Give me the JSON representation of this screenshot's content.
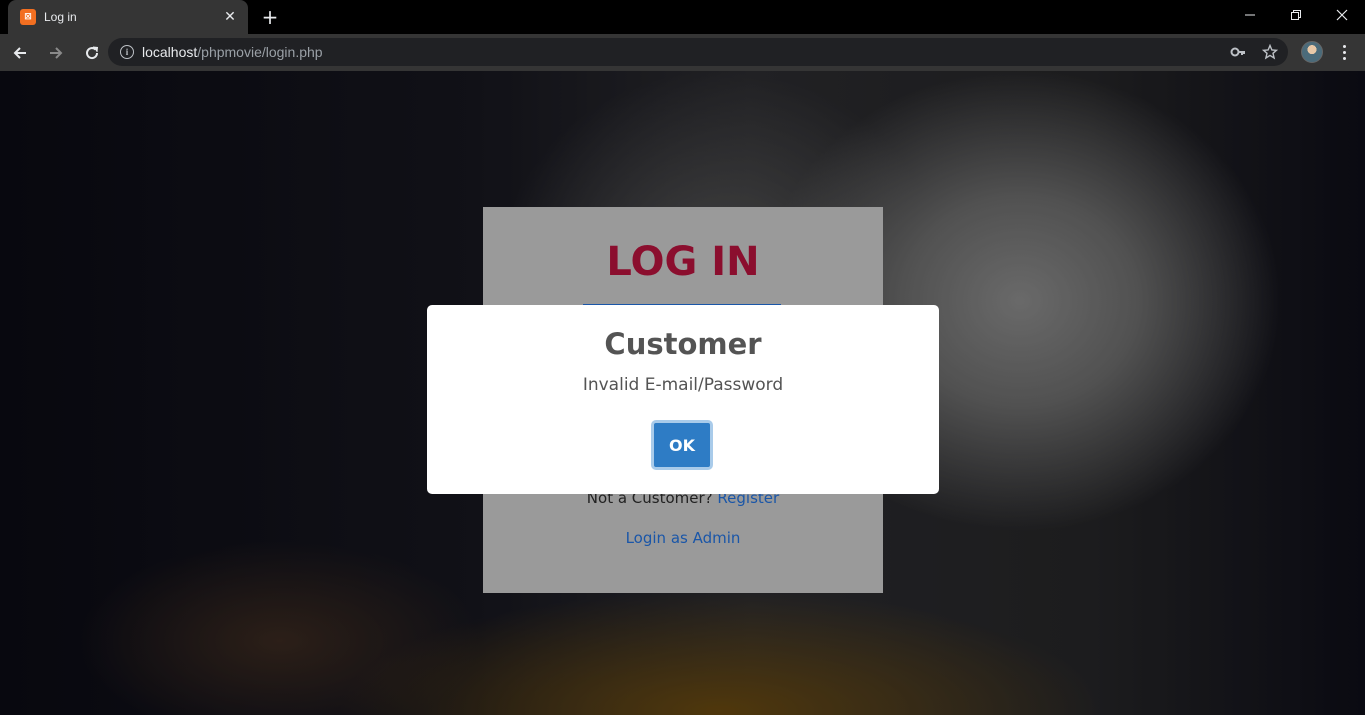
{
  "browser": {
    "tab_title": "Log in",
    "tab_favicon": "xampp-icon",
    "new_tab_label": "+",
    "url_host": "localhost",
    "url_path": "/phpmovie/login.php"
  },
  "login_card": {
    "title": "LOG IN",
    "not_customer_text": "Not a Customer?",
    "register_link": "Register",
    "admin_link": "Login as Admin"
  },
  "alert": {
    "title": "Customer",
    "message": "Invalid E-mail/Password",
    "ok_label": "OK"
  },
  "colors": {
    "login_title": "#8b0e2e",
    "link": "#1a56a8",
    "ok_button": "#2e7cc5",
    "card_bg": "#9a9a9a"
  }
}
